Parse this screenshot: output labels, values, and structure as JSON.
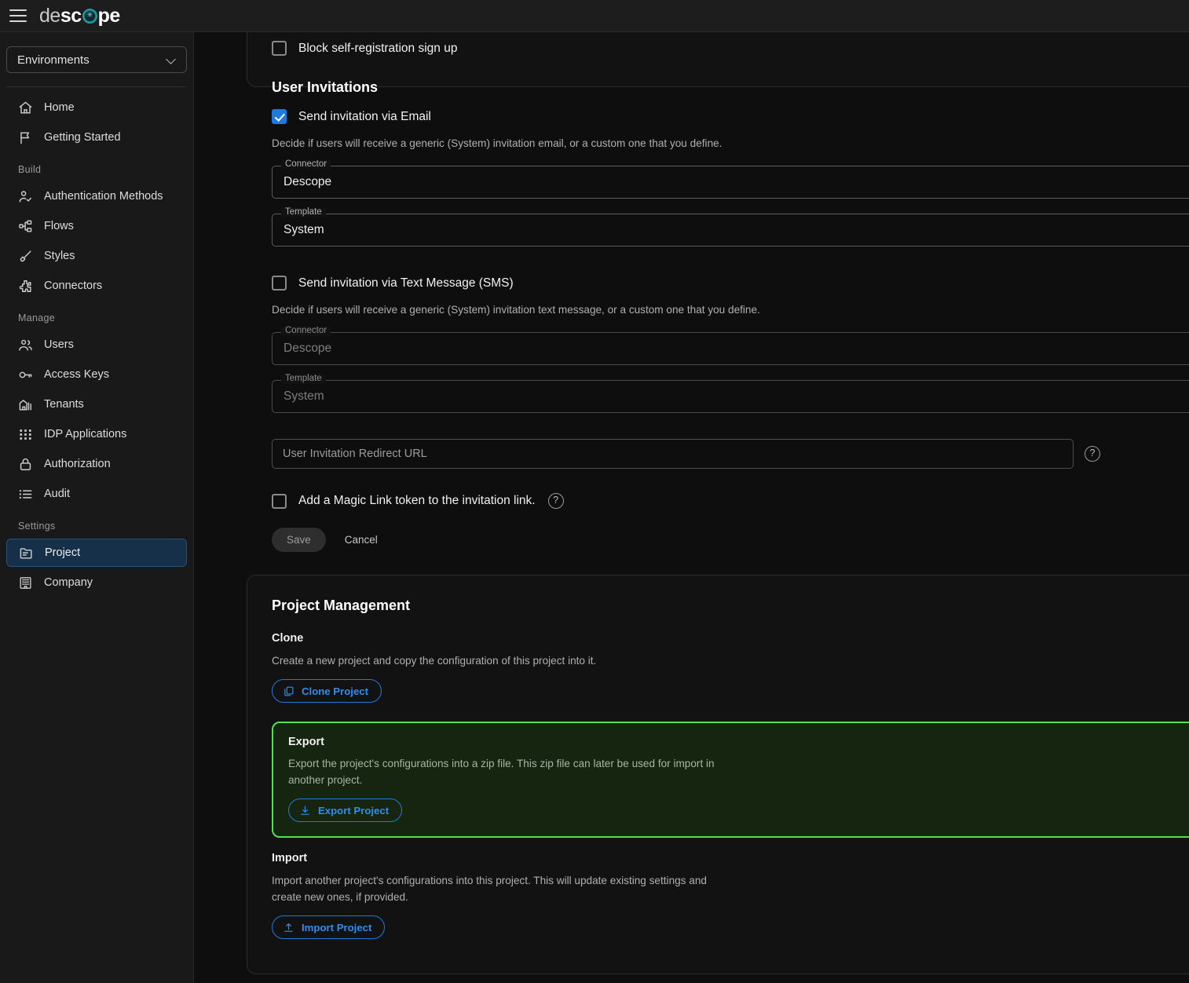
{
  "app": {
    "logo": {
      "part1": "de",
      "part2": "sc",
      "part3": "pe",
      "glyph": "descope-o-mark"
    },
    "menu_icon": "hamburger-menu-icon"
  },
  "sidebar": {
    "env_selector": {
      "label": "Environments",
      "caret": "chevron-down-icon"
    },
    "top_items": [
      {
        "label": "Home",
        "icon": "home-icon"
      },
      {
        "label": "Getting Started",
        "icon": "flag-icon"
      }
    ],
    "groups": [
      {
        "label": "Build",
        "items": [
          {
            "label": "Authentication Methods",
            "icon": "user-check-icon"
          },
          {
            "label": "Flows",
            "icon": "flow-nodes-icon"
          },
          {
            "label": "Styles",
            "icon": "paint-brush-icon"
          },
          {
            "label": "Connectors",
            "icon": "puzzle-piece-icon"
          }
        ]
      },
      {
        "label": "Manage",
        "items": [
          {
            "label": "Users",
            "icon": "users-icon"
          },
          {
            "label": "Access Keys",
            "icon": "key-icon"
          },
          {
            "label": "Tenants",
            "icon": "building-icon"
          },
          {
            "label": "IDP Applications",
            "icon": "grid-dots-icon"
          },
          {
            "label": "Authorization",
            "icon": "lock-icon"
          },
          {
            "label": "Audit",
            "icon": "list-icon"
          }
        ]
      },
      {
        "label": "Settings",
        "items": [
          {
            "label": "Project",
            "icon": "folder-icon",
            "active": true
          },
          {
            "label": "Company",
            "icon": "office-building-icon"
          }
        ]
      }
    ]
  },
  "invitations_panel": {
    "block_self_registration": {
      "label": "Block self-registration sign up",
      "checked": false
    },
    "section_title": "User Invitations",
    "email": {
      "checkbox_label": "Send invitation via Email",
      "checked": true,
      "description": "Decide if users will receive a generic (System) invitation email, or a custom one that you define.",
      "connector": {
        "legend": "Connector",
        "value": "Descope"
      },
      "template": {
        "legend": "Template",
        "value": "System"
      }
    },
    "sms": {
      "checkbox_label": "Send invitation via Text Message (SMS)",
      "checked": false,
      "description": "Decide if users will receive a generic (System) invitation text message, or a custom one that you define.",
      "connector": {
        "legend": "Connector",
        "value": "Descope"
      },
      "template": {
        "legend": "Template",
        "value": "System"
      }
    },
    "redirect_url": {
      "placeholder": "User Invitation Redirect URL",
      "value": "",
      "help_icon": "help-circle-icon"
    },
    "magic_link": {
      "label": "Add a Magic Link token to the invitation link.",
      "checked": false,
      "help_icon": "help-circle-icon"
    },
    "save_label": "Save",
    "cancel_label": "Cancel"
  },
  "project_panel": {
    "title": "Project Management",
    "clone": {
      "heading": "Clone",
      "description": "Create a new project and copy the configuration of this project into it.",
      "button_label": "Clone Project",
      "button_icon": "copy-icon"
    },
    "export": {
      "heading": "Export",
      "description": "Export the project's configurations into a zip file. This zip file can later be used for import in another project.",
      "button_label": "Export Project",
      "button_icon": "download-icon",
      "highlight_color": "#4ee44e"
    },
    "import": {
      "heading": "Import",
      "description": "Import another project's configurations into this project. This will update existing settings and create new ones, if provided.",
      "button_label": "Import Project",
      "button_icon": "upload-icon"
    }
  },
  "colors": {
    "accent_blue": "#1f7ae0",
    "highlight_green": "#4ee44e",
    "page_bg": "#0e0e0e",
    "sidebar_bg": "#191919",
    "panel_bg": "#121212"
  }
}
